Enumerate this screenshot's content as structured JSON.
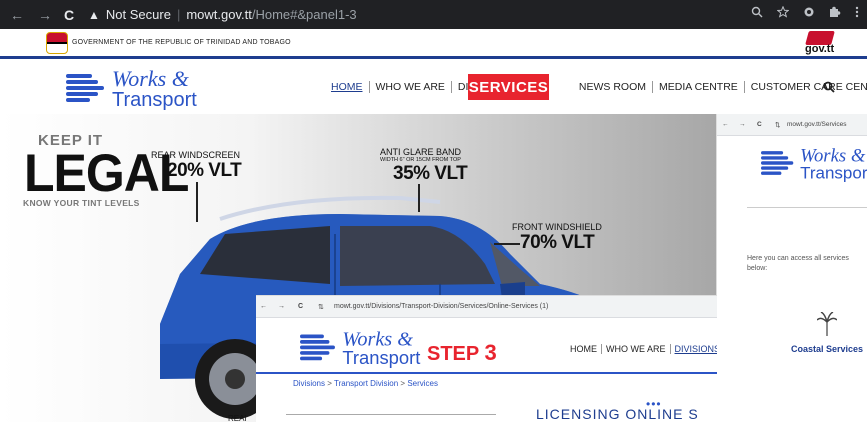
{
  "browser": {
    "back": "←",
    "forward": "→",
    "reload": "C",
    "warning": "▲",
    "not_secure": "Not Secure",
    "separator": "|",
    "host": "mowt.gov.tt",
    "path": "/Home#&panel1-3",
    "icons": [
      "search-icon",
      "star-icon",
      "extension-icon",
      "puzzle-icon",
      "menu-icon"
    ]
  },
  "gov_banner": {
    "text": "GOVERNMENT OF THE REPUBLIC OF TRINIDAD AND TOBAGO",
    "logo_text": "gov.tt"
  },
  "logo": {
    "line1": "Works &",
    "line2": "Transport"
  },
  "nav": {
    "items": [
      "HOME",
      "WHO WE ARE",
      "DIVISI",
      "NEWS ROOM",
      "MEDIA CENTRE",
      "CUSTOMER CARE CENTRE"
    ],
    "active": "HOME",
    "search_symbol": "Q"
  },
  "services_badge": "SERVICES",
  "hero": {
    "keep_it": "KEEP IT",
    "legal": "LEGAL",
    "know": "KNOW YOUR TINT LEVELS",
    "rear_label": "REAR WINDSCREEN",
    "rear_value": "20% VLT",
    "antiglare_label": "ANTI GLARE BAND",
    "antiglare_sub": "WIDTH 6\" OR 15CM FROM TOP",
    "antiglare_value": "35% VLT",
    "front_label": "FRONT WINDSHIELD",
    "front_value": "70% VLT",
    "cut_text": "REAI"
  },
  "inset_right": {
    "back": "←",
    "forward": "→",
    "reload": "C",
    "url": "mowt.gov.tt/Services",
    "logo_line1": "Works &",
    "logo_line2": "Transport",
    "access_text": "Here you can access all services below:",
    "coastal": "Coastal Services"
  },
  "inset_bottom": {
    "back": "←",
    "forward": "→",
    "reload": "C",
    "url": "mowt.gov.tt/Divisions/Transport-Division/Services/Online-Services (1)",
    "logo_line1": "Works &",
    "logo_line2": "Transport",
    "step_word": "STEP",
    "step_num": "3",
    "nav": [
      "HOME",
      "WHO WE ARE",
      "DIVISIONS"
    ],
    "crumb": [
      "Divisions",
      "Transport Division",
      "Services"
    ],
    "crumb_sep": ">",
    "dots": "•••",
    "heading": "LICENSING ONLINE S"
  },
  "colors": {
    "brand_blue": "#2b54c6",
    "navy": "#1e3d8f",
    "accent_red": "#e8242e",
    "car_blue": "#1f4fae"
  }
}
